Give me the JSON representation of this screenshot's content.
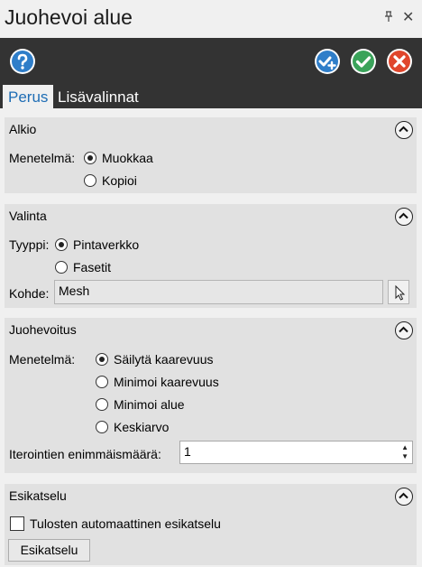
{
  "window": {
    "title": "Juohevoi alue",
    "pin_glyph": "⊥",
    "close_glyph": "✕"
  },
  "toolbar": {
    "help_icon": "question-icon",
    "apply_continue_icon": "check-plus-icon",
    "ok_icon": "check-icon",
    "cancel_icon": "x-icon"
  },
  "tabs": [
    {
      "label": "Perus",
      "active": true
    },
    {
      "label": "Lisävalinnat",
      "active": false
    }
  ],
  "alkio": {
    "title": "Alkio",
    "method_label": "Menetelmä:",
    "options": [
      {
        "label": "Muokkaa",
        "checked": true
      },
      {
        "label": "Kopioi",
        "checked": false
      }
    ]
  },
  "valinta": {
    "title": "Valinta",
    "type_label": "Tyyppi:",
    "options": [
      {
        "label": "Pintaverkko",
        "checked": true
      },
      {
        "label": "Fasetit",
        "checked": false
      }
    ],
    "target_label": "Kohde:",
    "target_value": "Mesh"
  },
  "juohevoitus": {
    "title": "Juohevoitus",
    "method_label": "Menetelmä:",
    "options": [
      {
        "label": "Säilytä kaarevuus",
        "checked": true
      },
      {
        "label": "Minimoi kaarevuus",
        "checked": false
      },
      {
        "label": "Minimoi alue",
        "checked": false
      },
      {
        "label": "Keskiarvo",
        "checked": false
      }
    ],
    "iterations_label": "Iterointien enimmäismäärä:",
    "iterations_value": "1"
  },
  "esikatselu": {
    "title": "Esikatselu",
    "auto_preview_label": "Tulosten automaattinen esikatselu",
    "auto_preview_checked": false,
    "preview_button_label": "Esikatselu"
  },
  "colors": {
    "toolbar_bg": "#333333",
    "tab_active_text": "#1e6db5",
    "help_blue": "#2f7ec9",
    "ok_green": "#3aa35a",
    "cancel_red": "#e0462c"
  }
}
